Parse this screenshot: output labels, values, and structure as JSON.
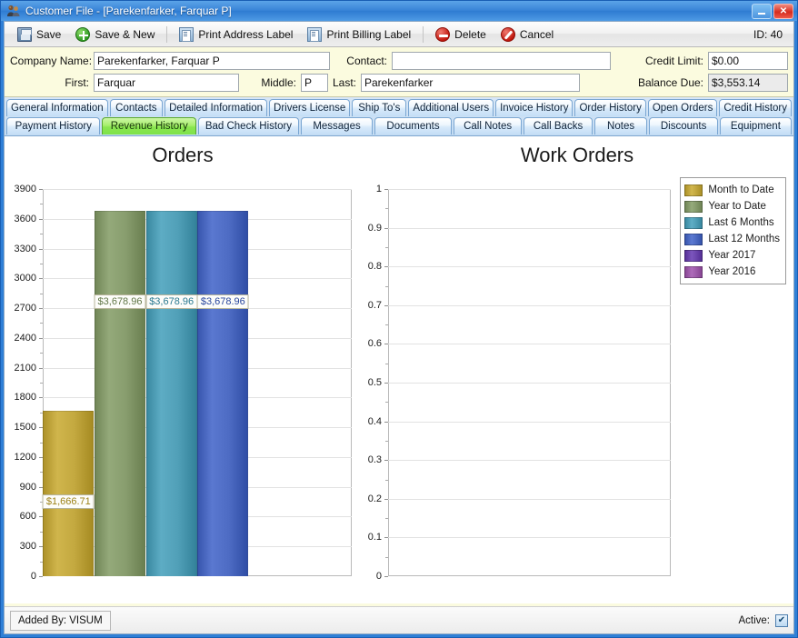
{
  "window": {
    "title": "Customer File - [Parekenfarker, Farquar P]",
    "icon": "people-icon",
    "minimize_label": "_",
    "close_label": "✕"
  },
  "toolbar": {
    "buttons": [
      {
        "label": "Save",
        "icon": "floppy-disk-icon"
      },
      {
        "label": "Save & New",
        "icon": "green-plus-icon"
      },
      {
        "label": "Print Address Label",
        "icon": "printer-icon"
      },
      {
        "label": "Print Billing Label",
        "icon": "printer-icon"
      },
      {
        "label": "Delete",
        "icon": "delete-circle-icon"
      },
      {
        "label": "Cancel",
        "icon": "cancel-circle-icon"
      }
    ],
    "id_text": "ID: 40"
  },
  "form": {
    "company_name_label": "Company Name:",
    "company_name_value": "Parekenfarker, Farquar P",
    "contact_label": "Contact:",
    "contact_value": "",
    "contact_placeholder": "",
    "first_label": "First:",
    "first_value": "Farquar",
    "middle_label": "Middle:",
    "middle_value": "P",
    "last_label": "Last:",
    "last_value": "Parekenfarker",
    "credit_limit_label": "Credit Limit:",
    "credit_limit_value": "$0.00",
    "balance_due_label": "Balance Due:",
    "balance_due_value": "$3,553.14"
  },
  "tabs": {
    "row1": [
      {
        "label": "General Information",
        "active": false,
        "width": 128
      },
      {
        "label": "Contacts",
        "active": false,
        "width": 72
      },
      {
        "label": "Detailed Information",
        "active": false,
        "width": 135
      },
      {
        "label": "Drivers License",
        "active": false,
        "width": 105
      },
      {
        "label": "Ship To's",
        "active": false,
        "width": 74
      },
      {
        "label": "Additional Users",
        "active": false,
        "width": 110
      },
      {
        "label": "Invoice History",
        "active": false,
        "width": 100
      },
      {
        "label": "Order History",
        "active": false,
        "width": 95
      },
      {
        "label": "Open Orders",
        "active": false,
        "width": 88
      },
      {
        "label": "Credit History",
        "active": false,
        "width": 94
      }
    ],
    "row2": [
      {
        "label": "Payment History",
        "active": false,
        "width": 110
      },
      {
        "label": "Revenue History",
        "active": true,
        "width": 110
      },
      {
        "label": "Bad Check History",
        "active": false,
        "width": 118
      },
      {
        "label": "Messages",
        "active": false,
        "width": 84
      },
      {
        "label": "Documents",
        "active": false,
        "width": 90
      },
      {
        "label": "Call Notes",
        "active": false,
        "width": 80
      },
      {
        "label": "Call Backs",
        "active": false,
        "width": 80
      },
      {
        "label": "Notes",
        "active": false,
        "width": 62
      },
      {
        "label": "Discounts",
        "active": false,
        "width": 80
      },
      {
        "label": "Equipment",
        "active": false,
        "width": 84
      }
    ]
  },
  "chart_data": [
    {
      "type": "bar",
      "title": "Orders",
      "xlabel": "",
      "ylabel": "",
      "ylim": [
        0,
        3900
      ],
      "ytick_step": 300,
      "yticks": [
        0,
        300,
        600,
        900,
        1200,
        1500,
        1800,
        2100,
        2400,
        2700,
        3000,
        3300,
        3600,
        3900
      ],
      "grid": true,
      "categories": [
        "Month to Date",
        "Year to Date",
        "Last 6 Months",
        "Last 12 Months",
        "Year 2017",
        "Year 2016"
      ],
      "values": [
        1666.71,
        3678.96,
        3678.96,
        3678.96,
        0,
        0
      ],
      "data_labels": [
        "$1,666.71",
        "$3,678.96",
        "$3,678.96",
        "$3,678.96",
        "",
        ""
      ],
      "colors": [
        "#c0a53c",
        "#84996a",
        "#4d9cb4",
        "#4a68c0",
        "#6a44ab",
        "#9c5aa8"
      ]
    },
    {
      "type": "bar",
      "title": "Work Orders",
      "xlabel": "",
      "ylabel": "",
      "ylim": [
        0,
        1
      ],
      "ytick_step": 0.1,
      "yticks": [
        "0",
        "0.1",
        "0.2",
        "0.3",
        "0.4",
        "0.5",
        "0.6",
        "0.7",
        "0.8",
        "0.9",
        "1"
      ],
      "grid": true,
      "categories": [
        "Month to Date",
        "Year to Date",
        "Last 6 Months",
        "Last 12 Months",
        "Year 2017",
        "Year 2016"
      ],
      "values": [
        0,
        0,
        0,
        0,
        0,
        0
      ],
      "data_labels": [
        "",
        "",
        "",
        "",
        "",
        ""
      ],
      "colors": [
        "#c0a53c",
        "#84996a",
        "#4d9cb4",
        "#4a68c0",
        "#6a44ab",
        "#9c5aa8"
      ]
    }
  ],
  "legend": {
    "position": "right",
    "items": [
      {
        "label": "Month to Date",
        "color": "#c0a53c"
      },
      {
        "label": "Year to Date",
        "color": "#84996a"
      },
      {
        "label": "Last 6 Months",
        "color": "#4d9cb4"
      },
      {
        "label": "Last 12 Months",
        "color": "#4a68c0"
      },
      {
        "label": "Year 2017",
        "color": "#6a44ab"
      },
      {
        "label": "Year 2016",
        "color": "#9c5aa8"
      }
    ]
  },
  "statusbar": {
    "added_by": "Added By: VISUM",
    "active_label": "Active:",
    "active_checked": true,
    "check_glyph": "✔"
  }
}
